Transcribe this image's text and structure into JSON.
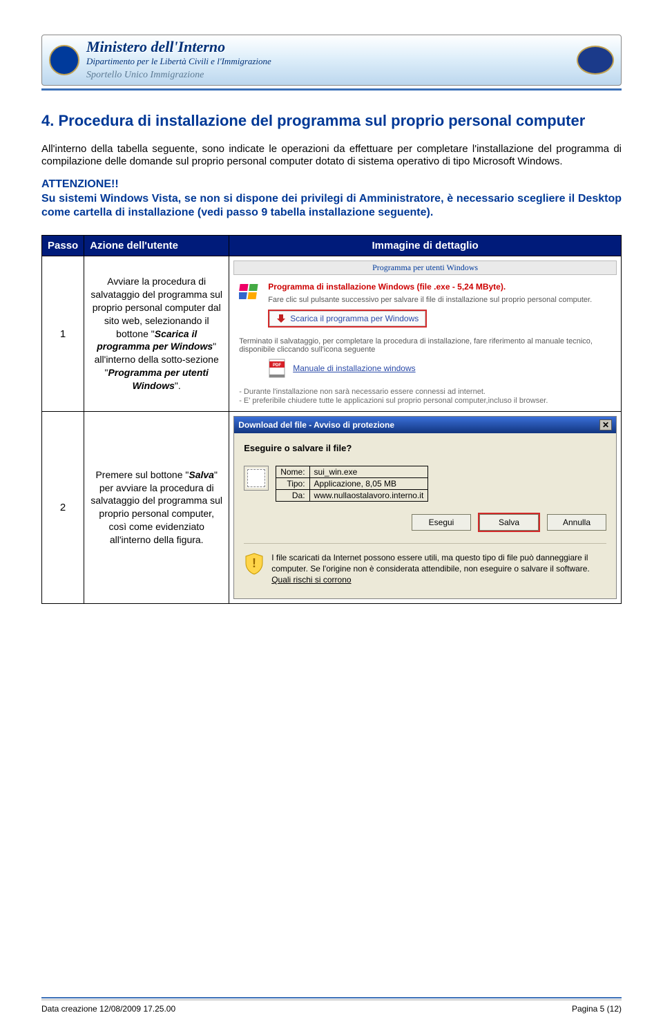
{
  "banner": {
    "title": "Ministero dell'Interno",
    "subtitle": "Dipartimento per le Libertà Civili e l'Immigrazione",
    "slogan": "Sportello Unico Immigrazione"
  },
  "section": {
    "num_title": "4.  Procedura di installazione del programma sul proprio personal computer",
    "para1": "All'interno della tabella seguente, sono indicate le operazioni da effettuare per completare l'installazione del programma di compilazione delle domande sul proprio personal computer dotato di sistema operativo di tipo Microsoft Windows.",
    "warn_title": "ATTENZIONE!!",
    "warn_body": "Su sistemi Windows Vista, se non si dispone dei privilegi di Amministratore, è necessario scegliere il Desktop come cartella di installazione (vedi passo 9 tabella installazione seguente)."
  },
  "table": {
    "headers": {
      "passo": "Passo",
      "azione": "Azione dell'utente",
      "immagine": "Immagine di dettaglio"
    },
    "rows": [
      {
        "num": "1",
        "azione_pre": "Avviare la procedura di salvataggio del programma sul proprio personal computer dal sito web, selezionando il bottone \"",
        "azione_btn": "Scarica il programma per Windows",
        "azione_mid": "\" all'interno della sotto-sezione \"",
        "azione_sec": "Programma per utenti Windows",
        "azione_post": "\"."
      },
      {
        "num": "2",
        "azione_pre": "Premere sul bottone \"",
        "azione_btn": "Salva",
        "azione_post": "\" per avviare la procedura di salvataggio del programma sul proprio personal computer, così come evidenziato all'interno della figura."
      }
    ]
  },
  "shot1": {
    "panel_title": "Programma per utenti Windows",
    "line_title": "Programma di installazione Windows (file .exe - 5,24 MByte).",
    "small1": "Fare clic sul pulsante successivo per salvare il file di installazione sul proprio personal computer.",
    "dl_label": "Scarica il programma per Windows",
    "small2": "Terminato il salvataggio, per completare la procedura di installazione, fare riferimento al manuale tecnico, disponibile cliccando sull'icona seguente",
    "manual_label": "Manuale di installazione windows",
    "note1": "- Durante l'installazione non sarà necessario essere connessi ad internet.",
    "note2": "- E' preferibile chiudere tutte le applicazioni sul proprio personal computer,incluso il browser."
  },
  "shot2": {
    "title": "Download del file - Avviso di protezione",
    "question": "Eseguire o salvare il file?",
    "labels": {
      "nome": "Nome:",
      "tipo": "Tipo:",
      "da": "Da:"
    },
    "values": {
      "nome": "sui_win.exe",
      "tipo": "Applicazione, 8,05 MB",
      "da": "www.nullaostalavoro.interno.it"
    },
    "buttons": {
      "esegui": "Esegui",
      "salva": "Salva",
      "annulla": "Annulla"
    },
    "warn_text": "I file scaricati da Internet possono essere utili, ma questo tipo di file può danneggiare il computer. Se l'origine non è considerata attendibile, non eseguire o salvare il software. ",
    "warn_link": "Quali rischi si corrono"
  },
  "footer": {
    "left": "Data creazione 12/08/2009 17.25.00",
    "right": "Pagina 5 (12)"
  }
}
